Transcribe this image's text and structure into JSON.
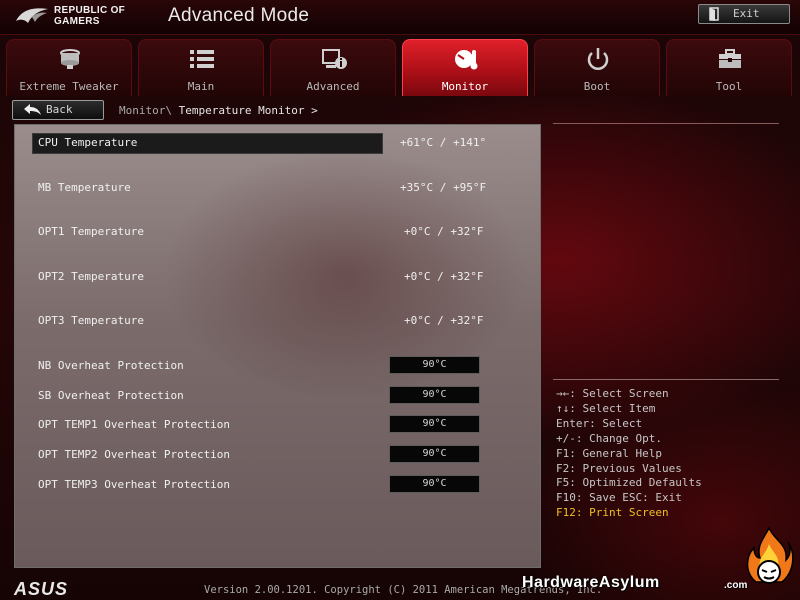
{
  "header": {
    "brand_line1": "REPUBLIC OF",
    "brand_line2": "GAMERS",
    "title": "Advanced Mode",
    "exit_label": "Exit"
  },
  "tabs": [
    {
      "label": "Extreme Tweaker",
      "icon": "fan-icon",
      "active": false
    },
    {
      "label": "Main",
      "icon": "list-icon",
      "active": false
    },
    {
      "label": "Advanced",
      "icon": "advanced-info-icon",
      "active": false
    },
    {
      "label": "Monitor",
      "icon": "monitor-gauge-icon",
      "active": true
    },
    {
      "label": "Boot",
      "icon": "power-icon",
      "active": false
    },
    {
      "label": "Tool",
      "icon": "toolbox-icon",
      "active": false
    }
  ],
  "nav": {
    "back_label": "Back",
    "crumb_parent": "Monitor\\",
    "crumb_current": "Temperature Monitor",
    "crumb_arrow": ">"
  },
  "temperatures": [
    {
      "label": "CPU Temperature",
      "value": "+61°C / +141°",
      "selected": true
    },
    {
      "label": "MB Temperature",
      "value": "+35°C / +95°F",
      "selected": false
    },
    {
      "label": "OPT1 Temperature",
      "value": "+0°C / +32°F",
      "selected": false
    },
    {
      "label": "OPT2 Temperature",
      "value": "+0°C / +32°F",
      "selected": false
    },
    {
      "label": "OPT3 Temperature",
      "value": "+0°C / +32°F",
      "selected": false
    }
  ],
  "protections": [
    {
      "label": "NB Overheat Protection",
      "value": "90°C"
    },
    {
      "label": "SB Overheat Protection",
      "value": "90°C"
    },
    {
      "label": "OPT TEMP1 Overheat Protection",
      "value": "90°C"
    },
    {
      "label": "OPT TEMP2 Overheat Protection",
      "value": "90°C"
    },
    {
      "label": "OPT TEMP3 Overheat Protection",
      "value": "90°C"
    }
  ],
  "help": [
    "→←: Select Screen",
    "↑↓: Select Item",
    "Enter: Select",
    "+/-: Change Opt.",
    "F1: General Help",
    "F2: Previous Values",
    "F5: Optimized Defaults",
    "F10: Save  ESC: Exit",
    "F12: Print Screen"
  ],
  "footer": {
    "asus_logo": "ASUS",
    "version": "Version 2.00.1201. Copyright (C) 2011 American Megatrends, Inc.",
    "watermark": "HardwareAsylum",
    "watermark_suffix": ".com"
  },
  "colors": {
    "accent": "#d0161f",
    "highlight": "#f0c020",
    "panel": "#8a7b7b"
  }
}
